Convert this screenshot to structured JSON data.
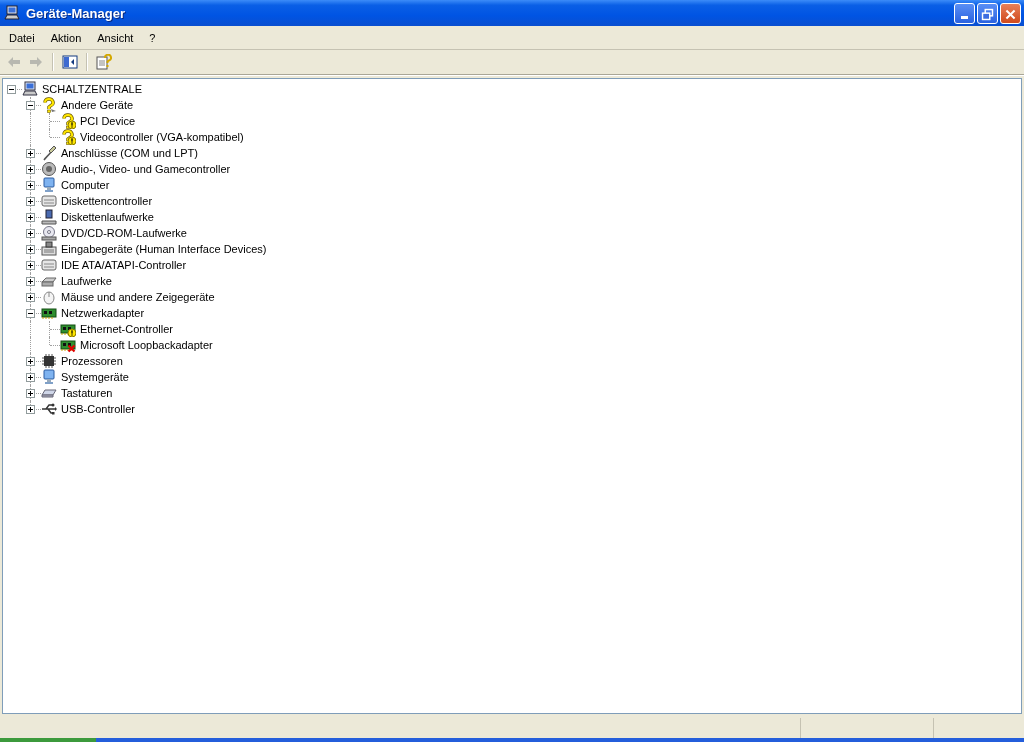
{
  "window": {
    "title": "Geräte-Manager"
  },
  "menu": [
    "Datei",
    "Aktion",
    "Ansicht",
    "?"
  ],
  "tree": [
    {
      "label": "SCHALTZENTRALE",
      "kind": "computer",
      "expanded": true,
      "children": [
        {
          "label": "Andere Geräte",
          "kind": "unknown",
          "expanded": true,
          "children": [
            {
              "label": "PCI Device",
              "kind": "unknown-warning"
            },
            {
              "label": "Videocontroller (VGA-kompatibel)",
              "kind": "unknown-warning"
            }
          ]
        },
        {
          "label": "Anschlüsse (COM und LPT)",
          "kind": "port",
          "expanded": false
        },
        {
          "label": "Audio-, Video- und Gamecontroller",
          "kind": "speaker",
          "expanded": false
        },
        {
          "label": "Computer",
          "kind": "monitor",
          "expanded": false
        },
        {
          "label": "Diskettencontroller",
          "kind": "controller",
          "expanded": false
        },
        {
          "label": "Diskettenlaufwerke",
          "kind": "floppy",
          "expanded": false
        },
        {
          "label": "DVD/CD-ROM-Laufwerke",
          "kind": "disc",
          "expanded": false
        },
        {
          "label": "Eingabegeräte (Human Interface Devices)",
          "kind": "hid",
          "expanded": false
        },
        {
          "label": "IDE ATA/ATAPI-Controller",
          "kind": "controller",
          "expanded": false
        },
        {
          "label": "Laufwerke",
          "kind": "drive",
          "expanded": false
        },
        {
          "label": "Mäuse und andere Zeigegeräte",
          "kind": "mouse",
          "expanded": false
        },
        {
          "label": "Netzwerkadapter",
          "kind": "network",
          "expanded": true,
          "children": [
            {
              "label": "Ethernet-Controller",
              "kind": "network-warning"
            },
            {
              "label": "Microsoft Loopbackadapter",
              "kind": "network-error"
            }
          ]
        },
        {
          "label": "Prozessoren",
          "kind": "cpu",
          "expanded": false
        },
        {
          "label": "Systemgeräte",
          "kind": "monitor",
          "expanded": false
        },
        {
          "label": "Tastaturen",
          "kind": "keyboard",
          "expanded": false
        },
        {
          "label": "USB-Controller",
          "kind": "usb",
          "expanded": false
        }
      ]
    }
  ]
}
